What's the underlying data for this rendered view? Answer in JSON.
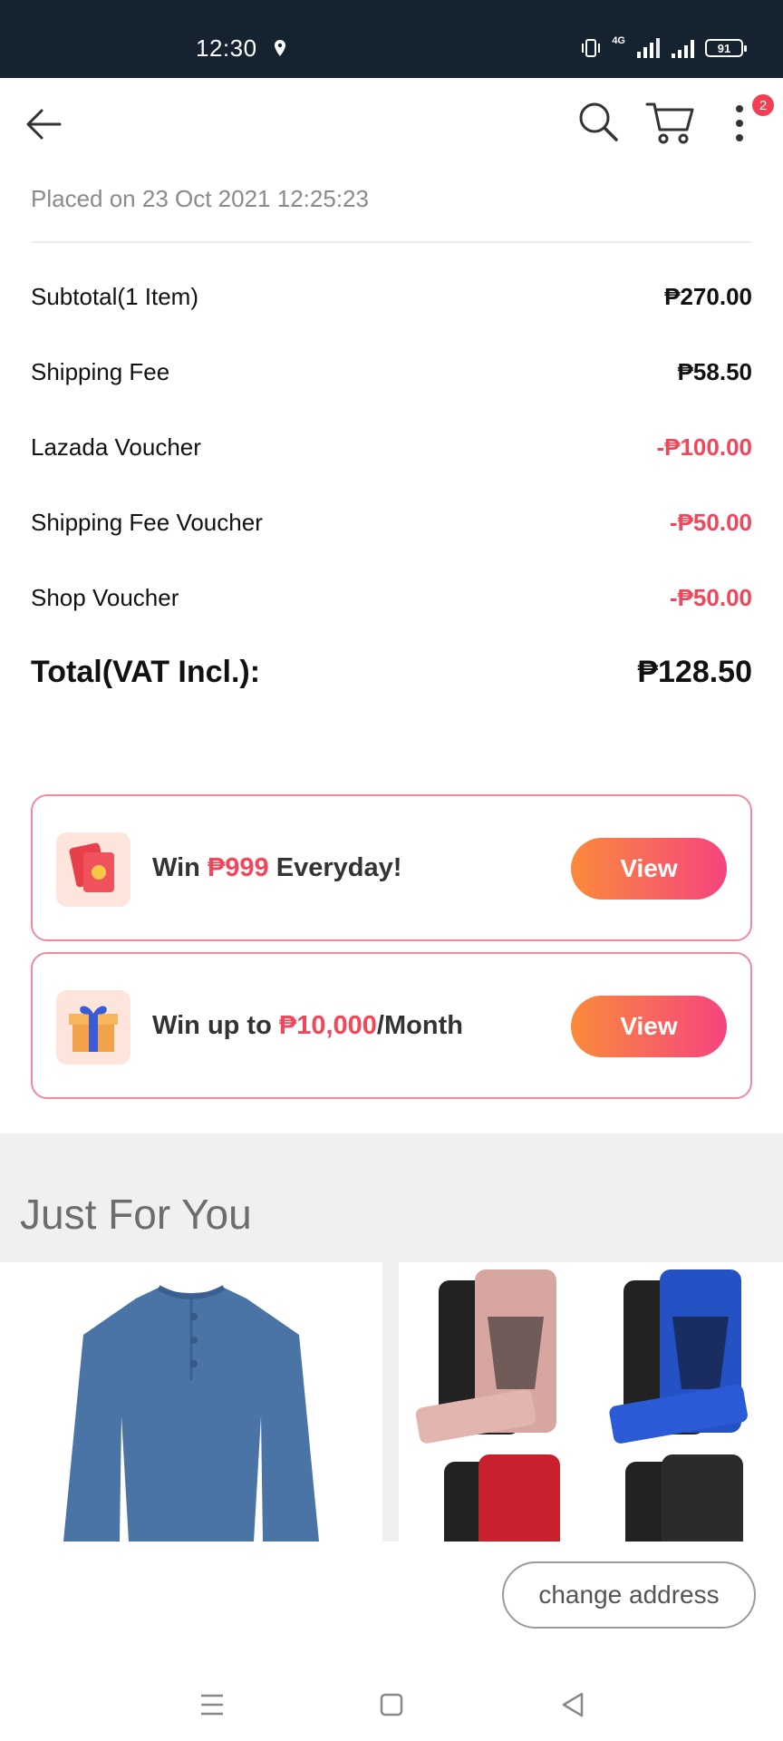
{
  "status": {
    "time": "12:30",
    "battery": "91",
    "network": "4G"
  },
  "header": {
    "cart_badge": "2"
  },
  "order": {
    "placed": "Placed on 23 Oct 2021  12:25:23",
    "rows": [
      {
        "label": "Subtotal(1 Item)",
        "value": "₱270.00"
      },
      {
        "label": "Shipping Fee",
        "value": "₱58.50"
      },
      {
        "label": "Lazada Voucher",
        "value": "-₱100.00"
      },
      {
        "label": "Shipping Fee Voucher",
        "value": "-₱50.00"
      },
      {
        "label": "Shop Voucher",
        "value": "-₱50.00"
      }
    ],
    "total_label": "Total(VAT Incl.):",
    "total_value": "₱128.50"
  },
  "promos": [
    {
      "pre": "Win ",
      "highlight": "₱999",
      "post": " Everyday!",
      "button": "View",
      "icon": "red-envelope-icon"
    },
    {
      "pre": "Win up to ",
      "highlight": "₱10,000",
      "post": "/Month",
      "button": "View",
      "icon": "gift-box-icon"
    }
  ],
  "just_for_you": {
    "title": "Just For You"
  },
  "change_address": "change address",
  "colors": {
    "accent_red": "#f0475a",
    "status_bar": "#15222f",
    "button_gradient_start": "#fb8a3c",
    "button_gradient_end": "#f5447e"
  }
}
